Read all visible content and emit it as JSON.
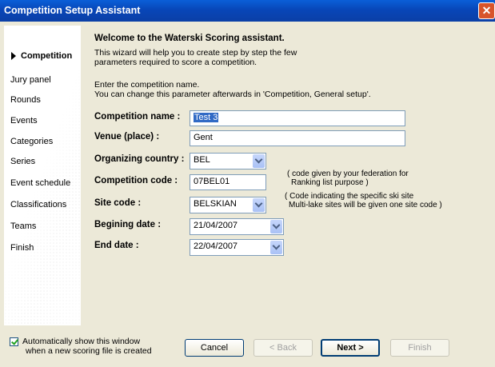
{
  "window": {
    "title": "Competition Setup Assistant",
    "close_glyph": "✕"
  },
  "sidebar": {
    "items": [
      {
        "label": "Competition",
        "active": true
      },
      {
        "label": "Jury panel"
      },
      {
        "label": "Rounds"
      },
      {
        "label": "Events"
      },
      {
        "label": "Categories"
      },
      {
        "label": "Series"
      },
      {
        "label": "Event schedule"
      },
      {
        "label": "Classifications"
      },
      {
        "label": "Teams"
      },
      {
        "label": "Finish"
      }
    ]
  },
  "main": {
    "welcome": "Welcome to the Waterski Scoring assistant.",
    "intro_line1": "This wizard will help you to create step by step the few",
    "intro_line2": "parameters required to score a competition.",
    "instr_line1": "Enter the competition name.",
    "instr_line2": "You can change this parameter afterwards in 'Competition, General setup'."
  },
  "form": {
    "competition_name": {
      "label": "Competition name :",
      "value": "Test 3"
    },
    "venue": {
      "label": "Venue (place) :",
      "value": "Gent"
    },
    "organizing_country": {
      "label": "Organizing country :",
      "value": "BEL"
    },
    "competition_code": {
      "label": "Competition code :",
      "value": "07BEL01",
      "note_line1": "( code given by your federation for",
      "note_line2": "Ranking list purpose )"
    },
    "site_code": {
      "label": "Site code :",
      "value": "BELSKIAN",
      "note_line1": "( Code indicating the specific ski site",
      "note_line2": "Multi-lake sites will be given one site code )"
    },
    "begin_date": {
      "label": "Begining date :",
      "value": "21/04/2007"
    },
    "end_date": {
      "label": "End date :",
      "value": "22/04/2007"
    }
  },
  "footer": {
    "auto_show_line1": "Automatically show this window",
    "auto_show_line2": "when a new scoring file is created",
    "auto_show_checked": true,
    "cancel": "Cancel",
    "back": "< Back",
    "next": "Next >",
    "finish": "Finish"
  },
  "colors": {
    "titlebar": "#0846b8",
    "dialog_bg": "#ece9d8",
    "selection": "#316ac5"
  }
}
